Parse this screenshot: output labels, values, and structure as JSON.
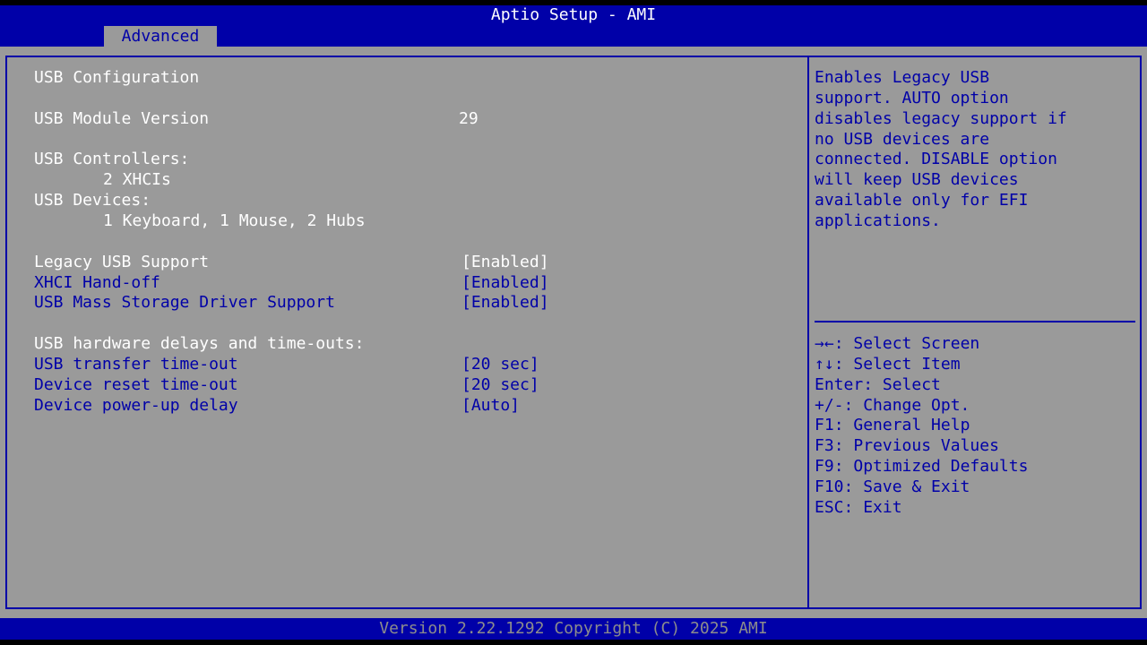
{
  "header": {
    "title": "Aptio Setup - AMI",
    "active_tab": "Advanced"
  },
  "left": {
    "section_title": "USB Configuration",
    "module_label": "USB Module Version",
    "module_value": "29",
    "controllers_label": "USB Controllers:",
    "controllers_value": "2 XHCIs",
    "devices_label": "USB Devices:",
    "devices_value": "1 Keyboard, 1 Mouse, 2 Hubs",
    "settings": [
      {
        "label": "Legacy USB Support",
        "value": "[Enabled]"
      },
      {
        "label": "XHCI Hand-off",
        "value": "[Enabled]"
      },
      {
        "label": "USB Mass Storage Driver Support",
        "value": "[Enabled]"
      }
    ],
    "delays_heading": "USB hardware delays and time-outs:",
    "delay_settings": [
      {
        "label": "USB transfer time-out",
        "value": "[20 sec]"
      },
      {
        "label": "Device reset time-out",
        "value": "[20 sec]"
      },
      {
        "label": "Device power-up delay",
        "value": "[Auto]"
      }
    ]
  },
  "help": {
    "description_lines": [
      "Enables Legacy USB",
      "support. AUTO option",
      "disables legacy support if",
      "no USB devices are",
      "connected. DISABLE option",
      "will keep USB devices",
      "available only for EFI",
      "applications."
    ],
    "keys": [
      {
        "key": "→←",
        "action": ": Select Screen",
        "icon": "left-right-arrows-icon"
      },
      {
        "key": "↑↓",
        "action": ": Select Item",
        "icon": "up-down-arrows-icon"
      },
      {
        "key": "Enter",
        "action": ": Select"
      },
      {
        "key": "+/-",
        "action": ": Change Opt."
      },
      {
        "key": "F1",
        "action": ": General Help"
      },
      {
        "key": "F3",
        "action": ": Previous Values"
      },
      {
        "key": "F9",
        "action": ": Optimized Defaults"
      },
      {
        "key": "F10",
        "action": ": Save & Exit"
      },
      {
        "key": "ESC",
        "action": ": Exit"
      }
    ]
  },
  "footer": {
    "text": "Version 2.22.1292 Copyright (C) 2025 AMI"
  },
  "colors": {
    "background": "#9a9a9a",
    "accent": "#0000a8",
    "text": "#ffffff",
    "footer_text": "#8c8c8c"
  }
}
